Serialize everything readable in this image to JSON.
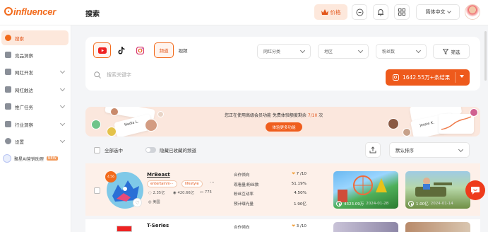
{
  "app": {
    "logo": "influencer"
  },
  "header": {
    "title": "搜索",
    "price_label": "价格",
    "language": "简体中文",
    "icons": [
      "crown-icon",
      "message-icon",
      "bell-icon",
      "grid-icon"
    ]
  },
  "sidebar": {
    "items": [
      {
        "label": "搜索",
        "active": true
      },
      {
        "label": "竞品洞察"
      },
      {
        "label": "网红开发"
      },
      {
        "label": "网红触达"
      },
      {
        "label": "推广任务"
      },
      {
        "label": "行业洞察"
      },
      {
        "label": "设置"
      }
    ],
    "ai_label": "聚星AI营销助理",
    "ai_badge": "NEW"
  },
  "search": {
    "platforms": [
      "youtube",
      "tiktok",
      "instagram"
    ],
    "type_tabs": [
      "频道",
      "视频"
    ],
    "dropdowns": [
      "网红分类",
      "地区",
      "粉丝数"
    ],
    "filter_label": "筛选",
    "placeholder": "搜索关键字",
    "result_label": "1642.55万+条结果"
  },
  "promo": {
    "text_pre": "您正在使用高级会员功能 免费体验额度剩余 ",
    "quota": "7/10",
    "text_post": " 次",
    "button": "体验更多功能",
    "card_names": [
      "Nadia L.",
      "Jessie K."
    ]
  },
  "list_toolbar": {
    "select_all": "全部选中",
    "hide_favorites": "隐藏已收藏的频道",
    "sort": "默认排序"
  },
  "influencers": [
    {
      "name": "MrBeast",
      "score": "4.56",
      "tags": [
        "entertainm···",
        "lifestyle"
      ],
      "more": "···",
      "subscribers": "2.35亿",
      "views": "420.66亿",
      "videos": "775",
      "country": "美国",
      "metrics": [
        {
          "label": "合作倾向",
          "value": "7 /10"
        },
        {
          "label": "观看量/粉丝数",
          "value": "51.19%"
        },
        {
          "label": "粉丝互动率",
          "value": "4.50%"
        },
        {
          "label": "预计曝光量",
          "value": "1.90亿"
        }
      ],
      "videos_list": [
        {
          "views": "4323.09万",
          "date": "2024-01-28"
        },
        {
          "views": "1.00亿",
          "date": "2024-01-14"
        }
      ]
    },
    {
      "name": "T-Series",
      "metrics": [
        {
          "label": "合作倾向",
          "value": "3 /10"
        }
      ]
    }
  ]
}
